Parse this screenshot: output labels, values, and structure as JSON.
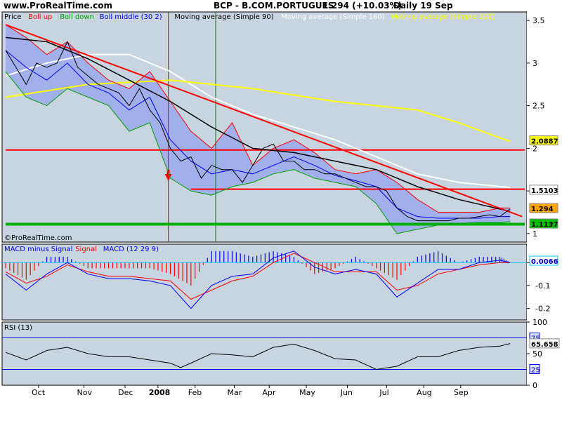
{
  "header": {
    "site": "www.ProRealTime.com",
    "instrument": "BCP - B.COM.PORTUGUES",
    "change": "1.294 (+10.03%)",
    "period": "Daily 19 Sep"
  },
  "price_legend": [
    {
      "text": "Price",
      "color": "#000000"
    },
    {
      "text": "Boll up",
      "color": "#ff0000"
    },
    {
      "text": "Boll down",
      "color": "#00a000"
    },
    {
      "text": "Boll middle (30 2)",
      "color": "#0000ff"
    },
    {
      "text": "Moving average (Simple 90)",
      "color": "#000000"
    },
    {
      "text": "Moving average (Simple 160)",
      "color": "#ffffff"
    },
    {
      "text": "Moving average (Simple 300)",
      "color": "#ffff00"
    }
  ],
  "macd_legend": [
    {
      "text": "MACD minus Signal",
      "color": "#0000ff"
    },
    {
      "text": "Signal",
      "color": "#ff0000"
    },
    {
      "text": "MACD (12 29 9)",
      "color": "#0000ff"
    }
  ],
  "rsi_legend": "RSI (13)",
  "copyright": "©ProRealTime.com",
  "chart_data": {
    "type": "line",
    "x_labels": [
      "Oct",
      "Nov",
      "Dec",
      "2008",
      "Feb",
      "Mar",
      "Apr",
      "May",
      "Jun",
      "Jul",
      "Aug",
      "Sep"
    ],
    "colors": {
      "panel_bg": "#c8d4e0",
      "up_band": "#ff0000",
      "down_band": "#00a000",
      "middle": "#0000ff",
      "ma90": "#000000",
      "ma160": "#ffffff",
      "ma300": "#ffff00",
      "fill": "#9aa8ec"
    },
    "price_panel": {
      "ylim": [
        0.9,
        3.6
      ],
      "yticks": [
        "3.5",
        "3",
        "2.5",
        "2",
        "1.5",
        "1"
      ],
      "tags": [
        {
          "label": "2.0887",
          "value": 2.0887,
          "bg": "#ffff00",
          "fg": "#000000"
        },
        {
          "label": "1.5103",
          "value": 1.5103,
          "bg": "#ffffff",
          "fg": "#000000"
        },
        {
          "label": "1.294",
          "value": 1.294,
          "bg": "#ffa500",
          "fg": "#000000"
        },
        {
          "label": "1.1137",
          "value": 1.1137,
          "bg": "#00c000",
          "fg": "#000000"
        }
      ],
      "price_x": [
        0,
        5,
        10,
        15,
        20,
        25,
        30,
        35,
        40,
        45,
        50,
        55,
        60,
        65,
        70,
        75,
        80,
        85,
        90,
        95,
        100,
        105,
        110,
        115,
        120,
        125,
        130,
        135,
        140,
        145,
        150,
        155,
        160,
        165,
        170,
        175,
        180,
        185,
        190,
        195,
        200,
        205,
        210,
        215,
        220,
        225,
        230,
        235,
        240,
        245
      ],
      "price": [
        3.15,
        2.95,
        2.75,
        3.0,
        2.95,
        3.0,
        3.25,
        2.95,
        2.85,
        2.75,
        2.7,
        2.65,
        2.5,
        2.7,
        2.45,
        2.3,
        2.0,
        1.85,
        1.9,
        1.65,
        1.8,
        1.75,
        1.75,
        1.6,
        1.8,
        2.0,
        2.05,
        1.85,
        1.85,
        1.75,
        1.75,
        1.7,
        1.7,
        1.65,
        1.6,
        1.55,
        1.55,
        1.5,
        1.3,
        1.2,
        1.15,
        1.15,
        1.15,
        1.15,
        1.18,
        1.18,
        1.2,
        1.22,
        1.2,
        1.29
      ],
      "boll_up_x": [
        0,
        10,
        20,
        30,
        40,
        50,
        60,
        70,
        80,
        90,
        100,
        110,
        120,
        130,
        140,
        150,
        160,
        170,
        180,
        190,
        200,
        210,
        220,
        230,
        240,
        245
      ],
      "boll_up": [
        3.45,
        3.3,
        3.1,
        3.25,
        3.0,
        2.8,
        2.7,
        2.9,
        2.55,
        2.2,
        2.0,
        2.3,
        1.8,
        2.0,
        2.1,
        1.95,
        1.75,
        1.7,
        1.75,
        1.6,
        1.4,
        1.25,
        1.25,
        1.25,
        1.3,
        1.3
      ],
      "boll_down": [
        2.9,
        2.6,
        2.5,
        2.7,
        2.6,
        2.5,
        2.2,
        2.3,
        1.65,
        1.5,
        1.45,
        1.55,
        1.6,
        1.7,
        1.75,
        1.65,
        1.6,
        1.55,
        1.35,
        1.0,
        1.05,
        1.1,
        1.12,
        1.13,
        1.13,
        1.14
      ],
      "boll_mid": [
        3.15,
        2.95,
        2.8,
        3.0,
        2.75,
        2.65,
        2.45,
        2.6,
        2.1,
        1.85,
        1.7,
        1.75,
        1.7,
        1.8,
        1.9,
        1.8,
        1.68,
        1.62,
        1.55,
        1.3,
        1.2,
        1.18,
        1.18,
        1.18,
        1.2,
        1.2
      ],
      "ma_x": [
        0,
        20,
        40,
        60,
        80,
        100,
        120,
        140,
        160,
        180,
        200,
        220,
        245
      ],
      "ma90": [
        3.3,
        3.25,
        3.05,
        2.8,
        2.55,
        2.25,
        2.0,
        1.95,
        1.85,
        1.75,
        1.55,
        1.4,
        1.26
      ],
      "ma160_x": [
        0,
        20,
        40,
        60,
        80,
        100,
        120,
        140,
        160,
        180,
        200,
        220,
        245
      ],
      "ma160": [
        2.85,
        3.0,
        3.1,
        3.1,
        2.9,
        2.6,
        2.4,
        2.25,
        2.1,
        1.9,
        1.7,
        1.6,
        1.54
      ],
      "ma300_x": [
        0,
        40,
        80,
        120,
        160,
        200,
        220,
        245
      ],
      "ma300": [
        2.6,
        2.75,
        2.8,
        2.7,
        2.55,
        2.45,
        2.3,
        2.08
      ],
      "trendline": [
        {
          "x": 0,
          "y": 3.45
        },
        {
          "x": 248,
          "y": 1.2
        }
      ],
      "support": [
        {
          "x0": 0,
          "x1": 248,
          "y": 1.98,
          "color": "#ff0000",
          "width": 2
        },
        {
          "x0": 90,
          "x1": 248,
          "y": 1.52,
          "color": "#ff0000",
          "width": 2
        },
        {
          "x0": 0,
          "x1": 248,
          "y": 1.11,
          "color": "#00b000",
          "width": 4
        }
      ],
      "vlines": [
        {
          "x": 79,
          "color": "#ff0000"
        },
        {
          "x": 102,
          "color": "#008000"
        }
      ]
    },
    "macd_panel": {
      "ylim": [
        -0.25,
        0.08
      ],
      "yticks": [
        "0",
        "-0.1",
        "-0.2"
      ],
      "tag": {
        "label": "0.0066",
        "value": 0.0066
      },
      "x": [
        0,
        10,
        20,
        30,
        40,
        50,
        60,
        70,
        80,
        90,
        100,
        110,
        120,
        130,
        140,
        150,
        160,
        170,
        180,
        190,
        200,
        210,
        220,
        230,
        240,
        245
      ],
      "macd": [
        -0.05,
        -0.12,
        -0.05,
        0.0,
        -0.05,
        -0.07,
        -0.07,
        -0.08,
        -0.1,
        -0.2,
        -0.1,
        -0.06,
        -0.05,
        0.02,
        0.05,
        -0.02,
        -0.05,
        -0.03,
        -0.05,
        -0.15,
        -0.09,
        -0.03,
        -0.03,
        0.0,
        0.01,
        0.0
      ],
      "signal": [
        -0.04,
        -0.09,
        -0.06,
        -0.01,
        -0.04,
        -0.06,
        -0.06,
        -0.07,
        -0.08,
        -0.16,
        -0.12,
        -0.08,
        -0.06,
        0.0,
        0.04,
        0.0,
        -0.04,
        -0.04,
        -0.04,
        -0.12,
        -0.1,
        -0.05,
        -0.03,
        -0.01,
        0.0,
        0.0
      ]
    },
    "rsi_panel": {
      "ylim": [
        0,
        100
      ],
      "yticks": [
        "100",
        "50",
        "0"
      ],
      "levels": [
        {
          "label": "75",
          "value": 75
        },
        {
          "label": "25",
          "value": 25
        }
      ],
      "tag": {
        "label": "65.658",
        "value": 65.658
      },
      "x": [
        0,
        10,
        20,
        30,
        40,
        50,
        60,
        70,
        80,
        85,
        90,
        100,
        110,
        120,
        130,
        140,
        150,
        160,
        170,
        180,
        190,
        200,
        210,
        220,
        230,
        240,
        245
      ],
      "rsi": [
        52,
        40,
        55,
        60,
        50,
        45,
        45,
        40,
        35,
        28,
        35,
        50,
        48,
        45,
        60,
        65,
        55,
        42,
        40,
        25,
        30,
        45,
        45,
        55,
        60,
        62,
        66
      ]
    }
  }
}
